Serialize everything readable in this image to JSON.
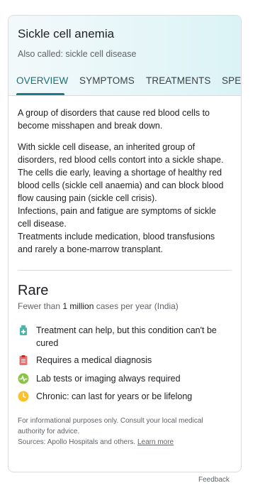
{
  "card": {
    "title": "Sickle cell anemia",
    "subtitle": "Also called: sickle cell disease",
    "tabs": [
      {
        "label": "OVERVIEW",
        "active": true
      },
      {
        "label": "SYMPTOMS",
        "active": false
      },
      {
        "label": "TREATMENTS",
        "active": false
      },
      {
        "label": "SPEC",
        "active": false
      }
    ],
    "overview": {
      "para1": "A group of disorders that cause red blood cells to become misshapen and break down.",
      "para2_lines": [
        "With sickle cell disease, an inherited group of disorders, red blood cells contort into a sickle shape. The cells die early, leaving a shortage of healthy red blood cells (sickle cell anaemia) and can block blood flow causing pain (sickle cell crisis).",
        "Infections, pain and fatigue are symptoms of sickle cell disease.",
        "Treatments include medication, blood transfusions and rarely a bone-marrow transplant."
      ]
    },
    "prevalence": {
      "label": "Rare",
      "freq_prefix": "Fewer than ",
      "freq_bold": "1 million",
      "freq_suffix": " cases per year (India)"
    },
    "features": [
      {
        "icon": "medicine-bottle-icon",
        "text": "Treatment can help, but this condition can't be cured",
        "color": "#4db6ac"
      },
      {
        "icon": "clipboard-icon",
        "text": "Requires a medical diagnosis",
        "color": "#e57373"
      },
      {
        "icon": "lab-test-icon",
        "text": "Lab tests or imaging always required",
        "color": "#8bc34a"
      },
      {
        "icon": "clock-icon",
        "text": "Chronic: can last for years or be lifelong",
        "color": "#fbc02d"
      }
    ],
    "footer": {
      "line1": "For informational purposes only. Consult your local medical authority for advice.",
      "sources_prefix": "Sources: Apollo Hospitals and others. ",
      "learn_more": "Learn more"
    }
  },
  "feedback_label": "Feedback"
}
